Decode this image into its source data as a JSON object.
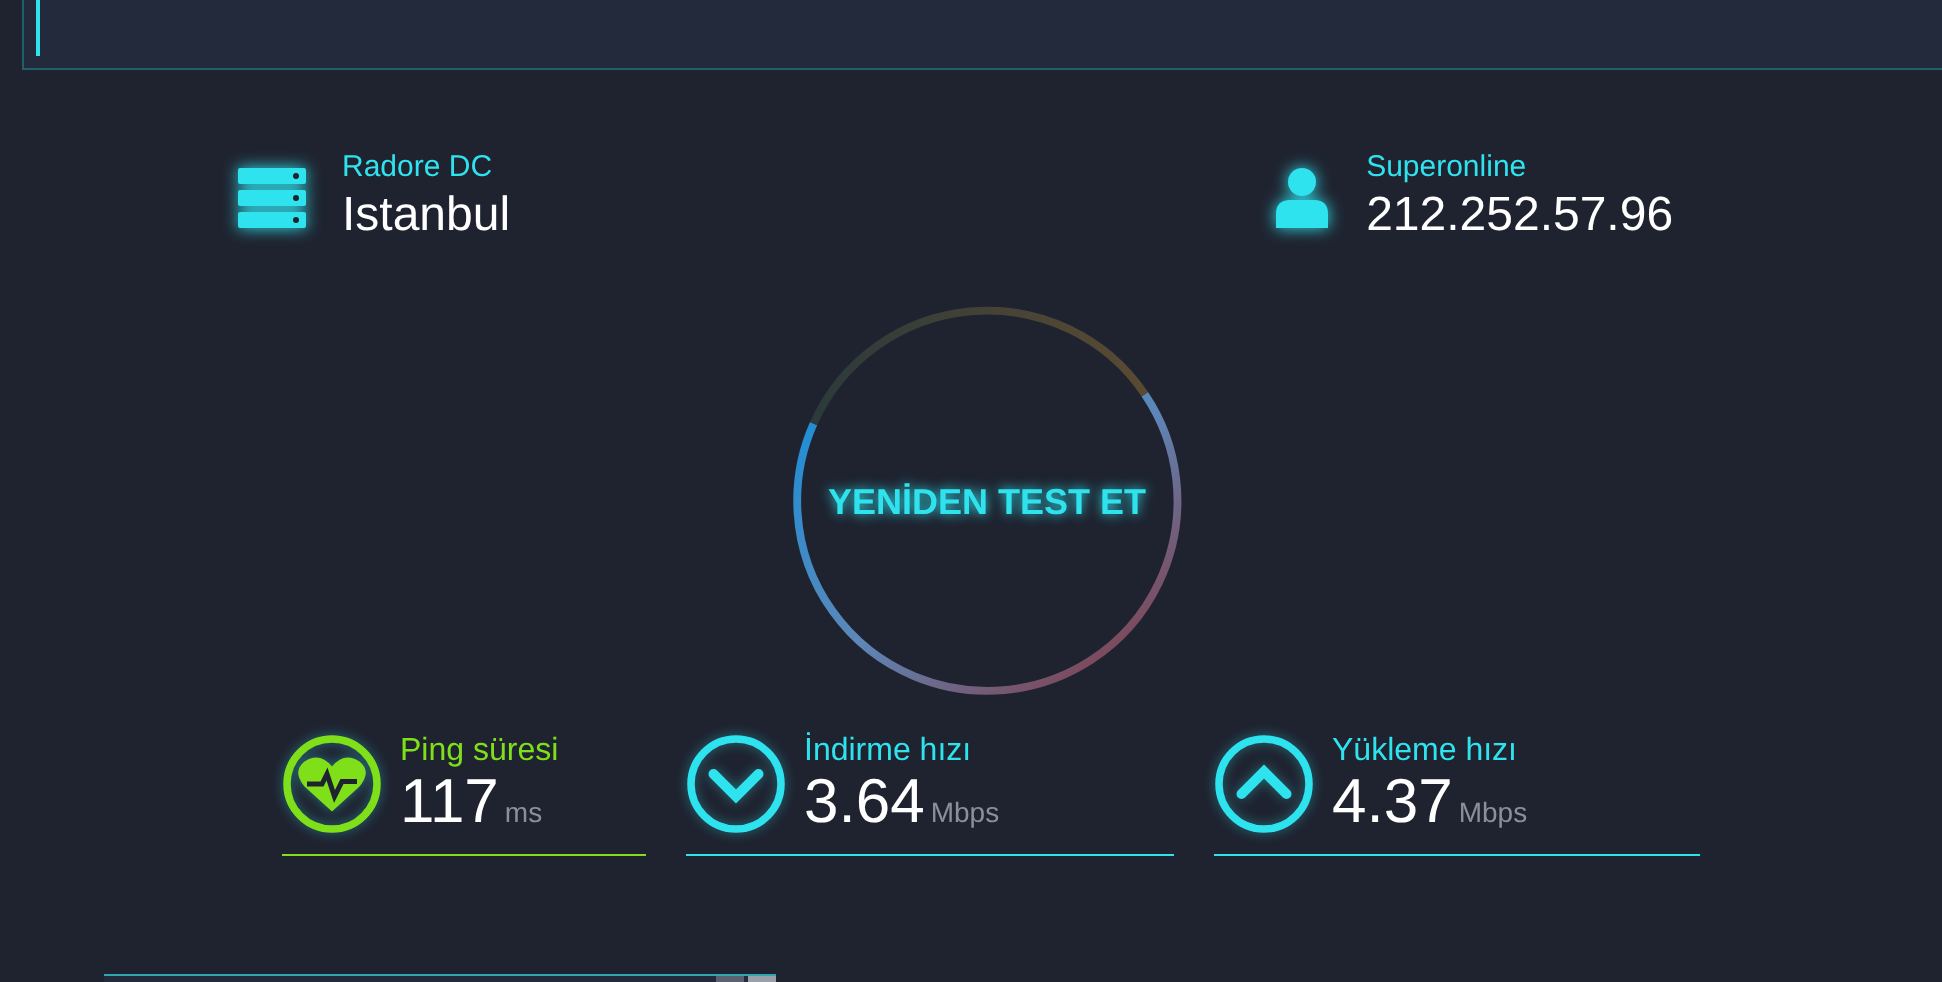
{
  "server": {
    "provider": "Radore DC",
    "location": "Istanbul"
  },
  "client": {
    "isp": "Superonline",
    "ip": "212.252.57.96"
  },
  "test_button": {
    "label": "YENİDEN TEST ET"
  },
  "metrics": [
    {
      "kind": "ping",
      "label": "Ping süresi",
      "value": "117",
      "unit": "ms",
      "color": "#7fe01a"
    },
    {
      "kind": "download",
      "label": "İndirme hızı",
      "value": "3.64",
      "unit": "Mbps",
      "color": "#2fe3ee"
    },
    {
      "kind": "upload",
      "label": "Yükleme hızı",
      "value": "4.37",
      "unit": "Mbps",
      "color": "#2fe3ee"
    }
  ]
}
